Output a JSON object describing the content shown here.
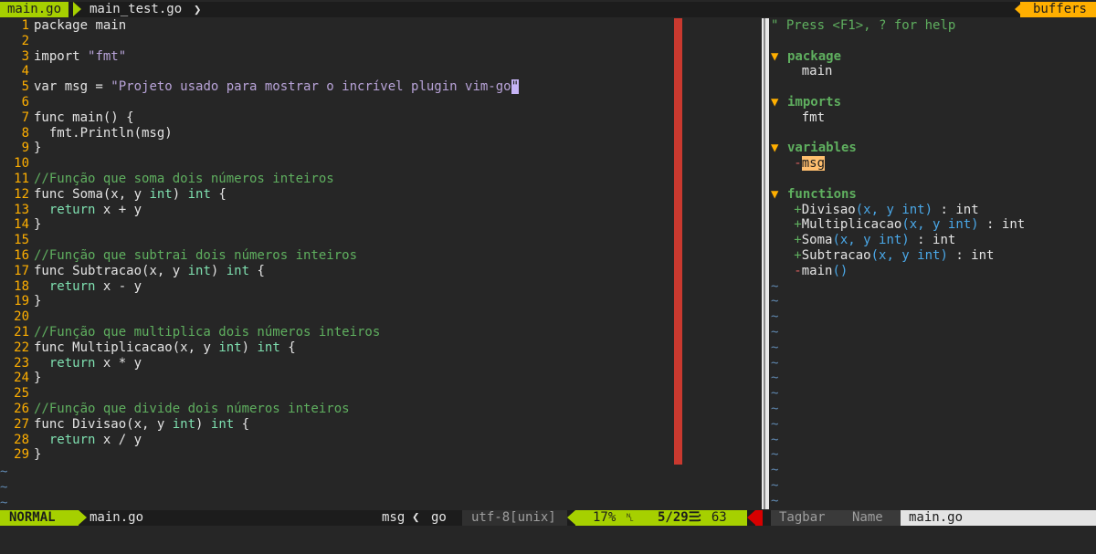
{
  "tabline": {
    "active_tab": "main.go",
    "inactive_tab": "main_test.go",
    "inactive_sep": "❯",
    "right_label": "buffers"
  },
  "editor": {
    "line_numbers": [
      "1",
      "2",
      "3",
      "4",
      "5",
      "6",
      "7",
      "8",
      "9",
      "10",
      "11",
      "12",
      "13",
      "14",
      "15",
      "16",
      "17",
      "18",
      "19",
      "20",
      "21",
      "22",
      "23",
      "24",
      "25",
      "26",
      "27",
      "28",
      "29"
    ],
    "lines": [
      [
        {
          "t": "package ",
          "c": "plain"
        },
        {
          "t": "main",
          "c": "plain"
        }
      ],
      [],
      [
        {
          "t": "import ",
          "c": "plain"
        },
        {
          "t": "\"fmt\"",
          "c": "str"
        }
      ],
      [],
      [
        {
          "t": "var ",
          "c": "plain"
        },
        {
          "t": "msg = ",
          "c": "plain"
        },
        {
          "t": "\"Projeto usado para mostrar o incrível plugin vim-go",
          "c": "str"
        },
        {
          "t": "\"",
          "c": "cursor"
        }
      ],
      [],
      [
        {
          "t": "func ",
          "c": "plain"
        },
        {
          "t": "main() {",
          "c": "plain"
        }
      ],
      [
        {
          "t": "  fmt.Println(msg)",
          "c": "plain"
        }
      ],
      [
        {
          "t": "}",
          "c": "plain"
        }
      ],
      [],
      [
        {
          "t": "//Função que soma dois números inteiros",
          "c": "cmt"
        }
      ],
      [
        {
          "t": "func ",
          "c": "plain"
        },
        {
          "t": "Soma(x, y ",
          "c": "plain"
        },
        {
          "t": "int",
          "c": "type"
        },
        {
          "t": ") ",
          "c": "plain"
        },
        {
          "t": "int",
          "c": "type"
        },
        {
          "t": " {",
          "c": "plain"
        }
      ],
      [
        {
          "t": "  return ",
          "c": "type"
        },
        {
          "t": "x + y",
          "c": "plain"
        }
      ],
      [
        {
          "t": "}",
          "c": "plain"
        }
      ],
      [],
      [
        {
          "t": "//Função que subtrai dois números inteiros",
          "c": "cmt"
        }
      ],
      [
        {
          "t": "func ",
          "c": "plain"
        },
        {
          "t": "Subtracao(x, y ",
          "c": "plain"
        },
        {
          "t": "int",
          "c": "type"
        },
        {
          "t": ") ",
          "c": "plain"
        },
        {
          "t": "int",
          "c": "type"
        },
        {
          "t": " {",
          "c": "plain"
        }
      ],
      [
        {
          "t": "  return ",
          "c": "type"
        },
        {
          "t": "x - y",
          "c": "plain"
        }
      ],
      [
        {
          "t": "}",
          "c": "plain"
        }
      ],
      [],
      [
        {
          "t": "//Função que multiplica dois números inteiros",
          "c": "cmt"
        }
      ],
      [
        {
          "t": "func ",
          "c": "plain"
        },
        {
          "t": "Multiplicacao(x, y ",
          "c": "plain"
        },
        {
          "t": "int",
          "c": "type"
        },
        {
          "t": ") ",
          "c": "plain"
        },
        {
          "t": "int",
          "c": "type"
        },
        {
          "t": " {",
          "c": "plain"
        }
      ],
      [
        {
          "t": "  return ",
          "c": "type"
        },
        {
          "t": "x * y",
          "c": "plain"
        }
      ],
      [
        {
          "t": "}",
          "c": "plain"
        }
      ],
      [],
      [
        {
          "t": "//Função que divide dois números inteiros",
          "c": "cmt"
        }
      ],
      [
        {
          "t": "func ",
          "c": "plain"
        },
        {
          "t": "Divisao(x, y ",
          "c": "plain"
        },
        {
          "t": "int",
          "c": "type"
        },
        {
          "t": ") ",
          "c": "plain"
        },
        {
          "t": "int",
          "c": "type"
        },
        {
          "t": " {",
          "c": "plain"
        }
      ],
      [
        {
          "t": "  return ",
          "c": "type"
        },
        {
          "t": "x / y",
          "c": "plain"
        }
      ],
      [
        {
          "t": "}",
          "c": "plain"
        }
      ]
    ],
    "empty_marker": "~"
  },
  "tagbar": {
    "help": "\" Press <F1>, ? for help",
    "fold_icon": "▼",
    "sections": [
      {
        "title": "package",
        "items": [
          {
            "vis": "",
            "name": "main",
            "sig": "",
            "ret": ""
          }
        ]
      },
      {
        "title": "imports",
        "items": [
          {
            "vis": "",
            "name": "fmt",
            "sig": "",
            "ret": ""
          }
        ]
      },
      {
        "title": "variables",
        "items": [
          {
            "vis": "-",
            "name": "msg",
            "sig": "",
            "ret": "",
            "hl": true
          }
        ]
      },
      {
        "title": "functions",
        "items": [
          {
            "vis": "+",
            "name": "Divisao",
            "sig": "(x, y int)",
            "ret": " : int"
          },
          {
            "vis": "+",
            "name": "Multiplicacao",
            "sig": "(x, y int)",
            "ret": " : int"
          },
          {
            "vis": "+",
            "name": "Soma",
            "sig": "(x, y int)",
            "ret": " : int"
          },
          {
            "vis": "+",
            "name": "Subtracao",
            "sig": "(x, y int)",
            "ret": " : int"
          },
          {
            "vis": "-",
            "name": "main",
            "sig": "()",
            "ret": ""
          }
        ]
      }
    ],
    "empty_marker": "~"
  },
  "statusline": {
    "mode": "NORMAL",
    "file": "main.go",
    "tag": "msg",
    "tag_sep": "❮",
    "filetype": "go",
    "encoding": "utf-8[unix]",
    "percent": "17%",
    "line_icon": "␤",
    "position": "5/29",
    "pos_icon": "☰",
    "column": ": 63",
    "tagbar_label": "Tagbar",
    "tagbar_sort": "Name",
    "tagbar_file": "main.go"
  },
  "colors": {
    "accent_green": "#a6d000",
    "accent_orange": "#ffaf00",
    "colorcolumn": "#c9392f",
    "warning": "#d70000"
  }
}
